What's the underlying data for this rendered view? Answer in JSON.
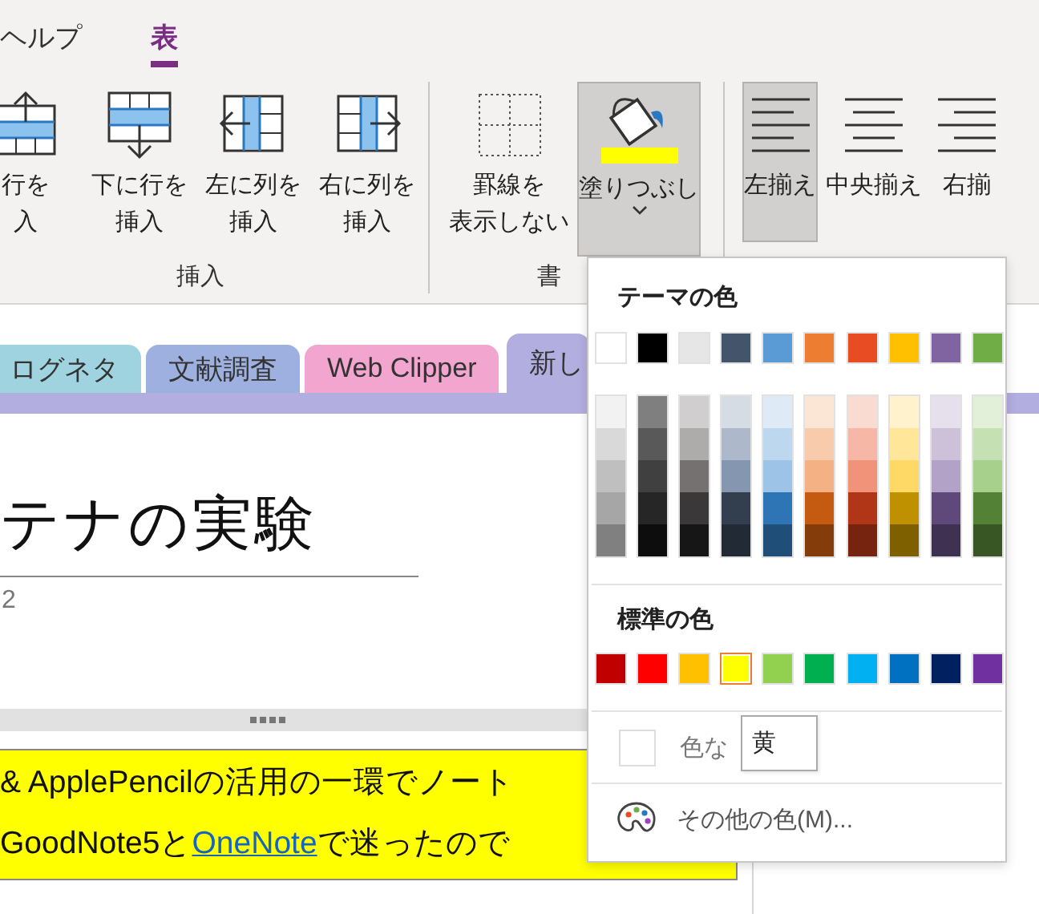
{
  "ribbon": {
    "tabs": [
      {
        "label": "ヘルプ",
        "selected": false
      },
      {
        "label": "表",
        "selected": true
      }
    ],
    "groups": [
      {
        "label": "挿入",
        "buttons": [
          {
            "kind": "row-above",
            "lines": [
              "行を",
              "入"
            ],
            "pressed": false
          },
          {
            "kind": "row-below",
            "lines": [
              "下に行を",
              "挿入"
            ],
            "pressed": false
          },
          {
            "kind": "col-left",
            "lines": [
              "左に列を",
              "挿入"
            ],
            "pressed": false
          },
          {
            "kind": "col-right",
            "lines": [
              "右に列を",
              "挿入"
            ],
            "pressed": false
          }
        ]
      },
      {
        "label": "書",
        "buttons": [
          {
            "kind": "borders",
            "lines": [
              "罫線を",
              "表示しない"
            ],
            "pressed": false
          },
          {
            "kind": "fill",
            "lines": [
              "塗りつぶし"
            ],
            "pressed": true,
            "color": "#ffff00"
          }
        ]
      },
      {
        "buttons": [
          {
            "kind": "align-left",
            "lines": [
              "左揃え"
            ],
            "pressed": true
          },
          {
            "kind": "align-center",
            "lines": [
              "中央揃え"
            ],
            "pressed": false
          },
          {
            "kind": "align-right",
            "lines": [
              "右揃"
            ],
            "pressed": false
          }
        ]
      }
    ]
  },
  "sections": [
    {
      "label": "ログネタ",
      "color": "#9fd3df",
      "selected": false
    },
    {
      "label": "文献調査",
      "color": "#9eb0e0",
      "selected": false
    },
    {
      "label": "Web Clipper",
      "color": "#f2a6cf",
      "selected": false
    },
    {
      "label": "新し",
      "color": "#b3aee0",
      "selected": true
    }
  ],
  "page": {
    "title": "テナの実験",
    "date": "2",
    "note_lines": [
      [
        {
          "kind": "text",
          "text": "& ApplePencilの活用の一環でノート"
        }
      ],
      [
        {
          "kind": "text",
          "text": "GoodNote5と"
        },
        {
          "kind": "link",
          "text": "OneNote"
        },
        {
          "kind": "text",
          "text": "で迷ったので"
        }
      ]
    ]
  },
  "fill_menu": {
    "theme_heading": "テーマの色",
    "theme_colors": [
      {
        "color": "#ffffff",
        "selected": false,
        "shades": [
          {
            "color": "#f2f2f2",
            "selected": false
          },
          {
            "color": "#d9d9d9",
            "selected": false
          },
          {
            "color": "#bfbfbf",
            "selected": false
          },
          {
            "color": "#a6a6a6",
            "selected": false
          },
          {
            "color": "#808080",
            "selected": false
          }
        ]
      },
      {
        "color": "#000000",
        "selected": false,
        "shades": [
          {
            "color": "#7f7f7f",
            "selected": false
          },
          {
            "color": "#595959",
            "selected": false
          },
          {
            "color": "#404040",
            "selected": false
          },
          {
            "color": "#262626",
            "selected": false
          },
          {
            "color": "#0d0d0d",
            "selected": false
          }
        ]
      },
      {
        "color": "#e7e6e6",
        "selected": false,
        "shades": [
          {
            "color": "#d0cece",
            "selected": false
          },
          {
            "color": "#aeabab",
            "selected": false
          },
          {
            "color": "#757171",
            "selected": false
          },
          {
            "color": "#3a3838",
            "selected": false
          },
          {
            "color": "#171616",
            "selected": false
          }
        ]
      },
      {
        "color": "#44546a",
        "selected": false,
        "shades": [
          {
            "color": "#d6dce4",
            "selected": false
          },
          {
            "color": "#adb9ca",
            "selected": false
          },
          {
            "color": "#8496b0",
            "selected": false
          },
          {
            "color": "#333f4f",
            "selected": false
          },
          {
            "color": "#222a35",
            "selected": false
          }
        ]
      },
      {
        "color": "#5b9bd5",
        "selected": false,
        "shades": [
          {
            "color": "#deebf6",
            "selected": false
          },
          {
            "color": "#bdd7ee",
            "selected": false
          },
          {
            "color": "#9dc3e6",
            "selected": false
          },
          {
            "color": "#2e75b5",
            "selected": false
          },
          {
            "color": "#1f4e79",
            "selected": false
          }
        ]
      },
      {
        "color": "#ed7d31",
        "selected": false,
        "shades": [
          {
            "color": "#fbe5d5",
            "selected": false
          },
          {
            "color": "#f8cbad",
            "selected": false
          },
          {
            "color": "#f4b183",
            "selected": false
          },
          {
            "color": "#c55a11",
            "selected": false
          },
          {
            "color": "#843c0b",
            "selected": false
          }
        ]
      },
      {
        "color": "#e84c22",
        "selected": false,
        "shades": [
          {
            "color": "#fadbd2",
            "selected": false
          },
          {
            "color": "#f6b7a6",
            "selected": false
          },
          {
            "color": "#f19379",
            "selected": false
          },
          {
            "color": "#b13618",
            "selected": false
          },
          {
            "color": "#762410",
            "selected": false
          }
        ]
      },
      {
        "color": "#ffc000",
        "selected": false,
        "shades": [
          {
            "color": "#fff2cc",
            "selected": false
          },
          {
            "color": "#ffe699",
            "selected": false
          },
          {
            "color": "#ffd966",
            "selected": false
          },
          {
            "color": "#bf9000",
            "selected": false
          },
          {
            "color": "#7f6000",
            "selected": false
          }
        ]
      },
      {
        "color": "#8064a2",
        "selected": false,
        "shades": [
          {
            "color": "#e5e0ec",
            "selected": false
          },
          {
            "color": "#ccc1d9",
            "selected": false
          },
          {
            "color": "#b2a2c7",
            "selected": false
          },
          {
            "color": "#5f497a",
            "selected": false
          },
          {
            "color": "#3f3151",
            "selected": false
          }
        ]
      },
      {
        "color": "#70ad47",
        "selected": false,
        "shades": [
          {
            "color": "#e2efd9",
            "selected": false
          },
          {
            "color": "#c5e0b3",
            "selected": false
          },
          {
            "color": "#a8d08d",
            "selected": false
          },
          {
            "color": "#538135",
            "selected": false
          },
          {
            "color": "#375623",
            "selected": false
          }
        ]
      }
    ],
    "standard_heading": "標準の色",
    "standard_colors": [
      {
        "color": "#c00000",
        "selected": false
      },
      {
        "color": "#ff0000",
        "selected": false
      },
      {
        "color": "#ffc000",
        "selected": false
      },
      {
        "color": "#ffff00",
        "selected": true
      },
      {
        "color": "#92d050",
        "selected": false
      },
      {
        "color": "#00b050",
        "selected": false
      },
      {
        "color": "#00b0f0",
        "selected": false
      },
      {
        "color": "#0070c0",
        "selected": false
      },
      {
        "color": "#002060",
        "selected": false
      },
      {
        "color": "#7030a0",
        "selected": false
      }
    ],
    "no_color": "色な",
    "tooltip": "黄",
    "more_colors": "その他の色(M)..."
  }
}
